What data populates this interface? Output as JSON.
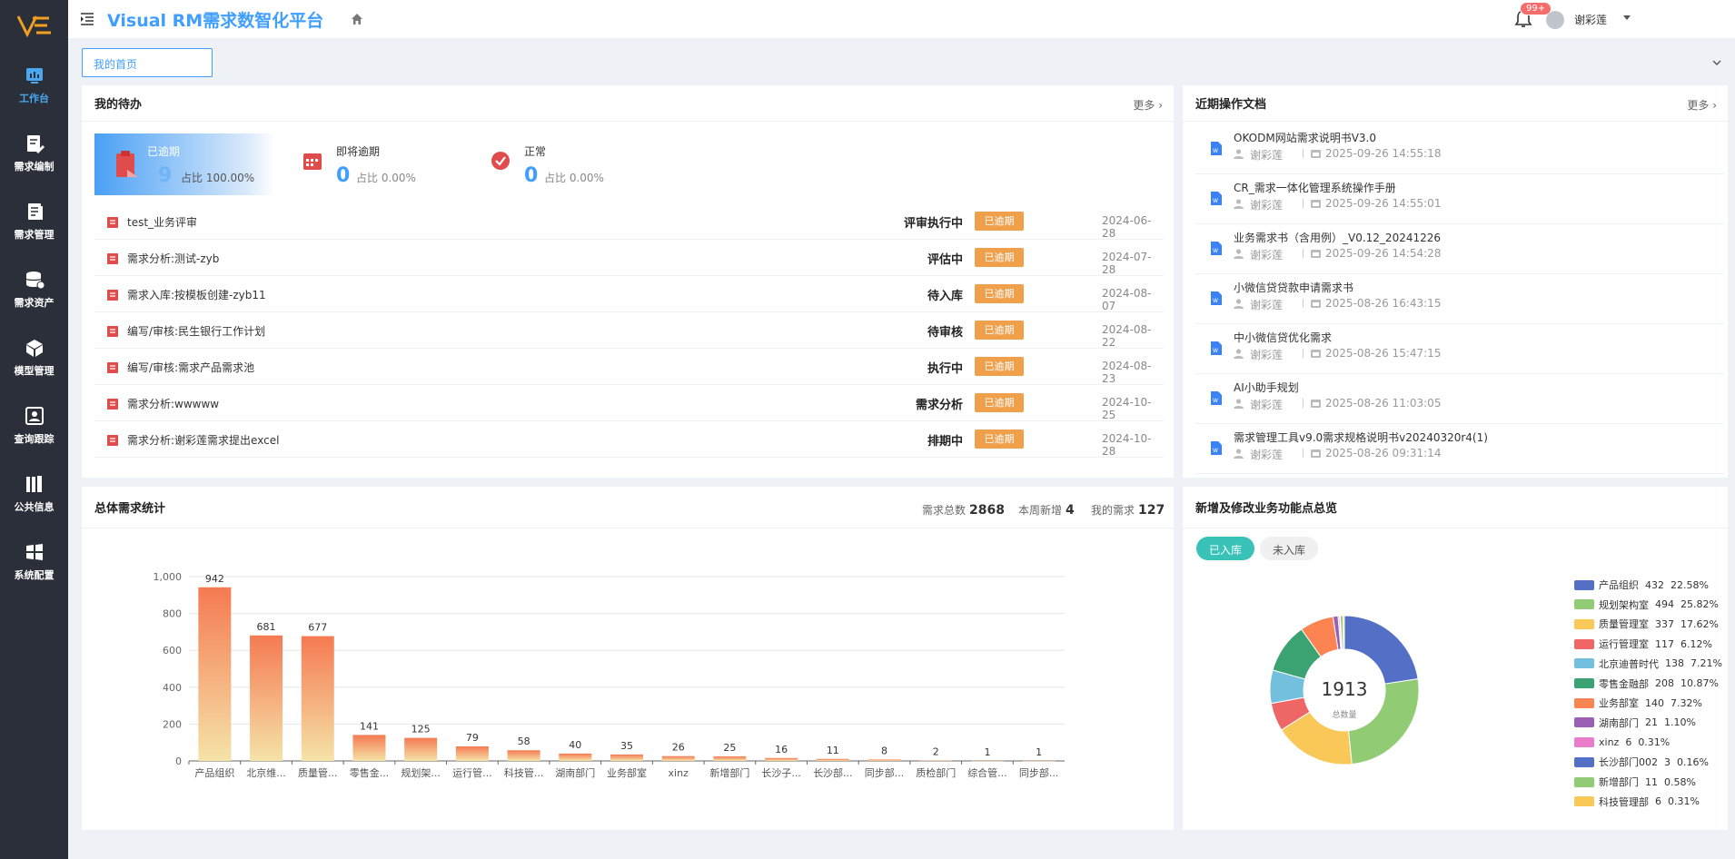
{
  "app": {
    "title": "Visual RM需求数智化平台"
  },
  "sidebar": {
    "items": [
      {
        "label": "工作台",
        "icon": "dashboard-icon"
      },
      {
        "label": "需求编制",
        "icon": "edit-doc-icon"
      },
      {
        "label": "需求管理",
        "icon": "document-icon"
      },
      {
        "label": "需求资产",
        "icon": "database-icon"
      },
      {
        "label": "模型管理",
        "icon": "cube-icon"
      },
      {
        "label": "查询跟踪",
        "icon": "search-track-icon"
      },
      {
        "label": "公共信息",
        "icon": "books-icon"
      },
      {
        "label": "系统配置",
        "icon": "windows-icon"
      }
    ]
  },
  "header": {
    "notification_count": "99+",
    "user_name": "谢彩莲"
  },
  "tabs": {
    "home": "我的首页"
  },
  "todo": {
    "title": "我的待办",
    "more": "更多",
    "stats": [
      {
        "label": "已逾期",
        "count": "9",
        "pct": "占比 100.00%"
      },
      {
        "label": "即将逾期",
        "count": "0",
        "pct": "占比 0.00%"
      },
      {
        "label": "正常",
        "count": "0",
        "pct": "占比 0.00%"
      }
    ],
    "rows": [
      {
        "title": "test_业务评审",
        "status": "评审执行中",
        "tag": "已逾期",
        "date": "2024-06-28"
      },
      {
        "title": "需求分析:测试-zyb",
        "status": "评估中",
        "tag": "已逾期",
        "date": "2024-07-28"
      },
      {
        "title": "需求入库:按模板创建-zyb11",
        "status": "待入库",
        "tag": "已逾期",
        "date": "2024-08-07"
      },
      {
        "title": "编写/审核:民生银行工作计划",
        "status": "待审核",
        "tag": "已逾期",
        "date": "2024-08-22"
      },
      {
        "title": "编写/审核:需求产品需求池",
        "status": "执行中",
        "tag": "已逾期",
        "date": "2024-08-23"
      },
      {
        "title": "需求分析:wwwww",
        "status": "需求分析",
        "tag": "已逾期",
        "date": "2024-10-25"
      },
      {
        "title": "需求分析:谢彩莲需求提出excel",
        "status": "排期中",
        "tag": "已逾期",
        "date": "2024-10-28"
      }
    ]
  },
  "recent_docs": {
    "title": "近期操作文档",
    "more": "更多",
    "rows": [
      {
        "title": "OKODM网站需求说明书V3.0",
        "user": "谢彩莲",
        "time": "2025-09-26 14:55:18"
      },
      {
        "title": "CR_需求一体化管理系统操作手册",
        "user": "谢彩莲",
        "time": "2025-09-26 14:55:01"
      },
      {
        "title": "业务需求书（含用例）_V0.12_20241226",
        "user": "谢彩莲",
        "time": "2025-09-26 14:54:28"
      },
      {
        "title": "小微信贷贷款申请需求书",
        "user": "谢彩莲",
        "time": "2025-08-26 16:43:15"
      },
      {
        "title": "中小微信贷优化需求",
        "user": "谢彩莲",
        "time": "2025-08-26 15:47:15"
      },
      {
        "title": "AI小助手规划",
        "user": "谢彩莲",
        "time": "2025-08-26 11:03:05"
      },
      {
        "title": "需求管理工具v9.0需求规格说明书v20240320r4(1)",
        "user": "谢彩莲",
        "time": "2025-08-26 09:31:14"
      }
    ]
  },
  "stats_panel": {
    "title": "总体需求统计",
    "total_label": "需求总数",
    "total": "2868",
    "week_label": "本周新增",
    "week": "4",
    "mine_label": "我的需求",
    "mine": "127"
  },
  "chart_data": [
    {
      "type": "bar",
      "categories": [
        "产品组织",
        "北京维...",
        "质量管...",
        "零售金...",
        "规划架...",
        "运行管...",
        "科技管...",
        "湖南部门",
        "业务部室",
        "xinz",
        "新增部门",
        "长沙子...",
        "长沙部...",
        "同步部...",
        "质检部门",
        "综合管...",
        "同步部..."
      ],
      "values": [
        942,
        681,
        677,
        141,
        125,
        79,
        58,
        40,
        35,
        26,
        25,
        16,
        11,
        8,
        2,
        1,
        1
      ],
      "yticks": [
        "0",
        "200",
        "400",
        "600",
        "800",
        "1,000"
      ],
      "ylim": [
        0,
        1000
      ],
      "colors": {
        "top": "#f57a52",
        "bottom": "#f5e3a8"
      }
    },
    {
      "type": "pie",
      "title": "新增及修改业务功能点总览",
      "center_value": "1913",
      "center_label": "总数量",
      "slices": [
        {
          "name": "产品组织",
          "value": 432,
          "pct": "22.58%",
          "color": "#5470c6"
        },
        {
          "name": "规划架构室",
          "value": 494,
          "pct": "25.82%",
          "color": "#91cc75"
        },
        {
          "name": "质量管理室",
          "value": 337,
          "pct": "17.62%",
          "color": "#fac858"
        },
        {
          "name": "运行管理室",
          "value": 117,
          "pct": "6.12%",
          "color": "#ee6666"
        },
        {
          "name": "北京迪普时代",
          "value": 138,
          "pct": "7.21%",
          "color": "#73c0de"
        },
        {
          "name": "零售金融部",
          "value": 208,
          "pct": "10.87%",
          "color": "#3ba272"
        },
        {
          "name": "业务部室",
          "value": 140,
          "pct": "7.32%",
          "color": "#fc8452"
        },
        {
          "name": "湖南部门",
          "value": 21,
          "pct": "1.10%",
          "color": "#9a60b4"
        },
        {
          "name": "xinz",
          "value": 6,
          "pct": "0.31%",
          "color": "#ea7ccc"
        },
        {
          "name": "长沙部门002",
          "value": 3,
          "pct": "0.16%",
          "color": "#5470c6"
        },
        {
          "name": "新增部门",
          "value": 11,
          "pct": "0.58%",
          "color": "#91cc75"
        },
        {
          "name": "科技管理部",
          "value": 6,
          "pct": "0.31%",
          "color": "#fac858"
        }
      ]
    }
  ],
  "pie_filters": {
    "active": "已入库",
    "inactive": "未入库"
  }
}
